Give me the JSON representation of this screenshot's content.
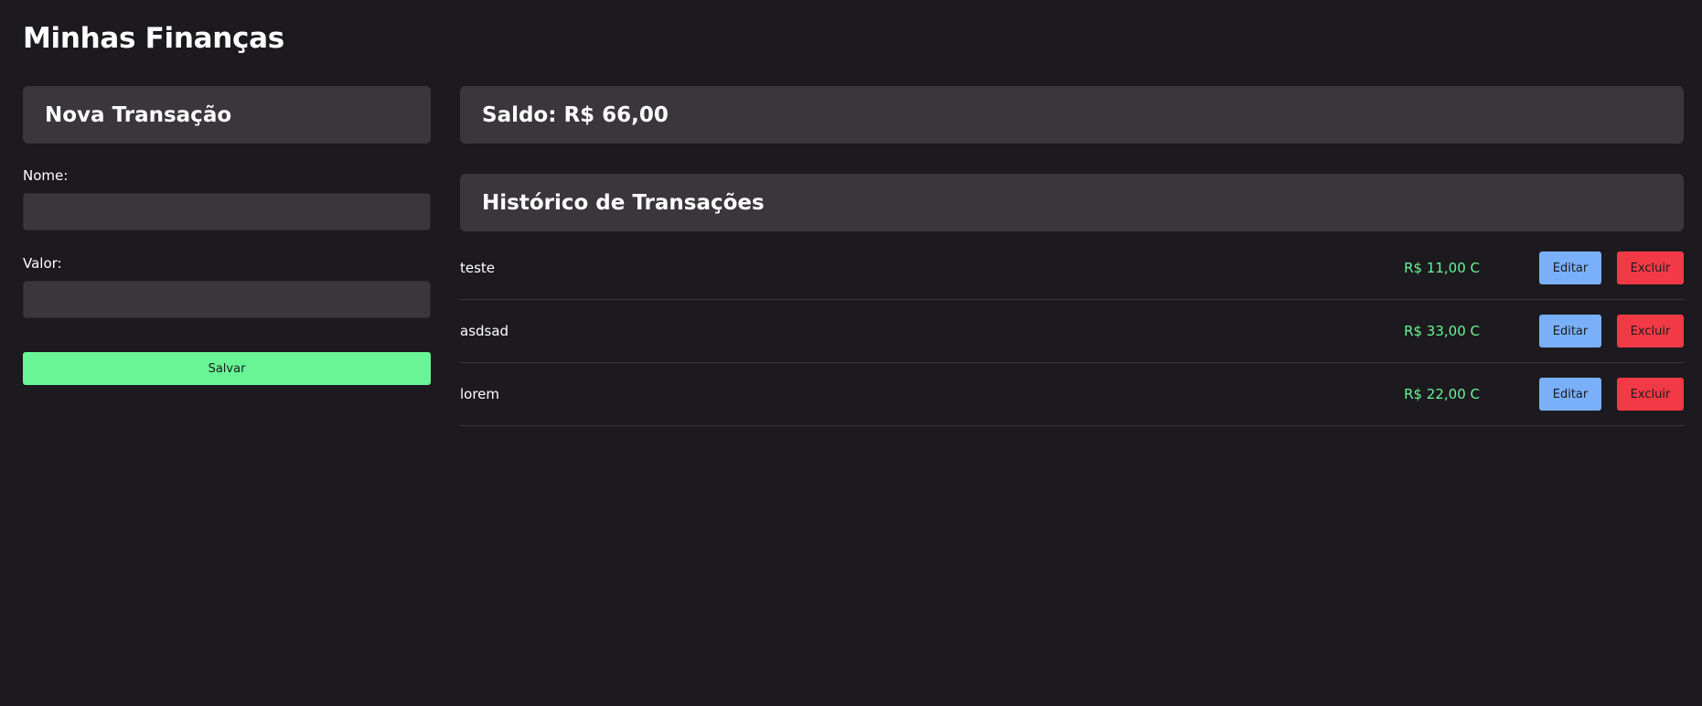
{
  "app": {
    "title": "Minhas Finanças"
  },
  "form": {
    "title": "Nova Transação",
    "name_label": "Nome:",
    "name_value": "",
    "value_label": "Valor:",
    "value_value": "",
    "save_label": "Salvar"
  },
  "balance": {
    "text": "Saldo: R$ 66,00"
  },
  "history": {
    "title": "Histórico de Transações",
    "edit_label": "Editar",
    "delete_label": "Excluir",
    "transactions": [
      {
        "name": "teste",
        "amount": "R$ 11,00 C"
      },
      {
        "name": "asdsad",
        "amount": "R$ 33,00 C"
      },
      {
        "name": "lorem",
        "amount": "R$ 22,00 C"
      }
    ]
  },
  "colors": {
    "background": "#1c1a1e",
    "panel": "#3a363c",
    "save": "#69f596",
    "credit": "#69f596",
    "edit": "#7ab0fa",
    "delete": "#f23a46"
  }
}
